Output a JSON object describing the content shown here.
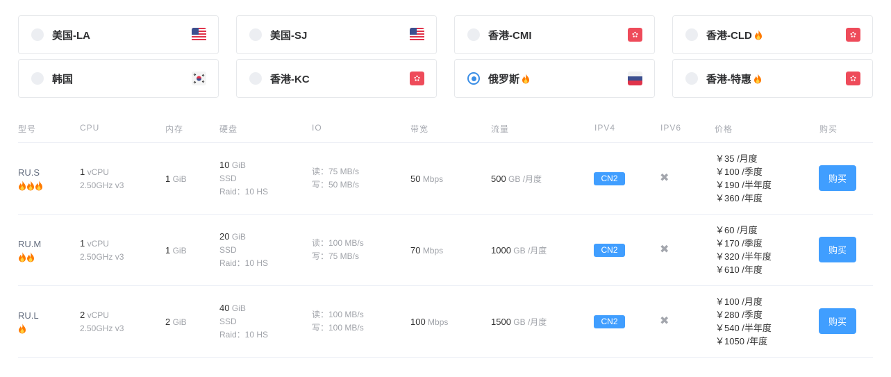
{
  "regions": [
    {
      "name": "美国-LA",
      "hot": false,
      "selected": false,
      "flag": "us-flag-icon"
    },
    {
      "name": "美国-SJ",
      "hot": false,
      "selected": false,
      "flag": "us-flag-icon"
    },
    {
      "name": "香港-CMI",
      "hot": false,
      "selected": false,
      "flag": "hk-flag-icon"
    },
    {
      "name": "香港-CLD",
      "hot": true,
      "selected": false,
      "flag": "hk-flag-icon"
    },
    {
      "name": "韩国",
      "hot": false,
      "selected": false,
      "flag": "kr-flag-icon"
    },
    {
      "name": "香港-KC",
      "hot": false,
      "selected": false,
      "flag": "hk-flag-icon"
    },
    {
      "name": "俄罗斯",
      "hot": true,
      "selected": true,
      "flag": "ru-flag-icon"
    },
    {
      "name": "香港-特惠",
      "hot": true,
      "selected": false,
      "flag": "hk-flag-icon"
    }
  ],
  "table": {
    "headers": {
      "model": "型号",
      "cpu": "CPU",
      "mem": "内存",
      "disk": "硬盘",
      "io": "IO",
      "bw": "带宽",
      "traffic": "流量",
      "ipv4": "IPV4",
      "ipv6": "IPV6",
      "price": "价格",
      "buy": "购买"
    },
    "rows": [
      {
        "model": "RU.S",
        "fires": 3,
        "cpu_count": "1",
        "cpu_unit": "vCPU",
        "cpu_freq": "2.50GHz v3",
        "mem": "1",
        "mem_unit": "GiB",
        "disk": "10",
        "disk_unit": "GiB",
        "disk_type": "SSD",
        "raid": "Raid：10 HS",
        "io_read": "读：75 MB/s",
        "io_write": "写：50 MB/s",
        "bw": "50",
        "bw_unit": "Mbps",
        "traffic": "500",
        "traffic_unit": "GB /月度",
        "ipv4": "CN2",
        "prices": [
          "￥35 /月度",
          "￥100 /季度",
          "￥190 /半年度",
          "￥360 /年度"
        ],
        "buy": "购买"
      },
      {
        "model": "RU.M",
        "fires": 2,
        "cpu_count": "1",
        "cpu_unit": "vCPU",
        "cpu_freq": "2.50GHz v3",
        "mem": "1",
        "mem_unit": "GiB",
        "disk": "20",
        "disk_unit": "GiB",
        "disk_type": "SSD",
        "raid": "Raid：10 HS",
        "io_read": "读：100 MB/s",
        "io_write": "写：75 MB/s",
        "bw": "70",
        "bw_unit": "Mbps",
        "traffic": "1000",
        "traffic_unit": "GB /月度",
        "ipv4": "CN2",
        "prices": [
          "￥60 /月度",
          "￥170 /季度",
          "￥320 /半年度",
          "￥610 /年度"
        ],
        "buy": "购买"
      },
      {
        "model": "RU.L",
        "fires": 1,
        "cpu_count": "2",
        "cpu_unit": "vCPU",
        "cpu_freq": "2.50GHz v3",
        "mem": "2",
        "mem_unit": "GiB",
        "disk": "40",
        "disk_unit": "GiB",
        "disk_type": "SSD",
        "raid": "Raid：10 HS",
        "io_read": "读：100 MB/s",
        "io_write": "写：100 MB/s",
        "bw": "100",
        "bw_unit": "Mbps",
        "traffic": "1500",
        "traffic_unit": "GB /月度",
        "ipv4": "CN2",
        "prices": [
          "￥100 /月度",
          "￥280 /季度",
          "￥540 /半年度",
          "￥1050 /年度"
        ],
        "buy": "购买"
      }
    ]
  },
  "colors": {
    "accent": "#409eff",
    "radio_on": "#3a8ee6",
    "flag_red": "#ee4b5a",
    "fire": "#ff7a00"
  },
  "icons": {
    "fire": "fire-icon",
    "ipv6_unavailable": "x-mark-icon"
  }
}
